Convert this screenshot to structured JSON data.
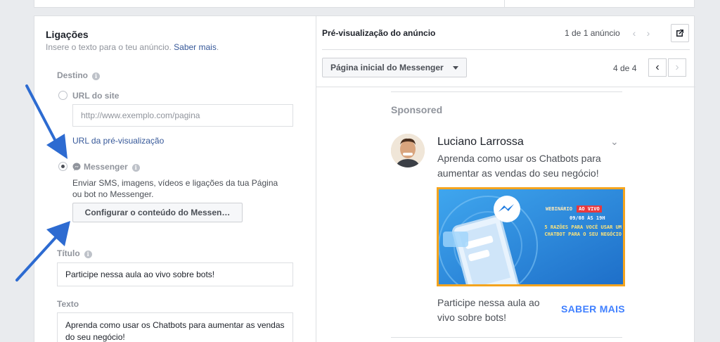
{
  "connections": {
    "title": "Ligações",
    "subtitle": "Insere o texto para o teu anúncio.",
    "learn_more": "Saber mais",
    "learn_more_suffix": ".",
    "destination_label": "Destino",
    "options": {
      "website_url_label": "URL do site",
      "website_url_placeholder": "http://www.exemplo.com/pagina",
      "preview_url_link": "URL da pré-visualização",
      "messenger_label": "Messenger",
      "messenger_description": "Enviar SMS, imagens, vídeos e ligações da tua Página ou bot no Messenger.",
      "configure_button": "Configurar o conteúdo do Messen…",
      "selected": "Messenger"
    },
    "headline_label": "Título",
    "headline_value": "Participe nessa aula ao vivo sobre bots!",
    "text_label": "Texto",
    "text_value": "Aprenda como usar os Chatbots para aumentar as vendas do seu negócio!"
  },
  "preview": {
    "title": "Pré-visualização do anúncio",
    "ad_count": "1 de 1 anúncio",
    "placement_dropdown": "Página inicial do Messenger",
    "placement_page": "4 de 4",
    "sponsored": "Sponsored",
    "author": "Luciano Larrossa",
    "caption": "Aprenda como usar os Chatbots para aumentar as vendas do seu negócio!",
    "ad_image": {
      "tag": "WEBINÁRIO",
      "tag_badge": "AO VIVO",
      "date": "09/08 ÀS 19H",
      "headline_line1": "5 RAZÕES PARA VOCÊ USAR UM",
      "headline_line2": "CHATBOT PARA O SEU NEGÓCIO"
    },
    "ad_text": "Participe nessa aula ao vivo sobre bots!",
    "cta": "SABER MAIS"
  },
  "colors": {
    "link": "#365899",
    "cta": "#4080ff",
    "annotation_arrow": "#2d6bd1",
    "ad_border": "#f4a41e"
  }
}
